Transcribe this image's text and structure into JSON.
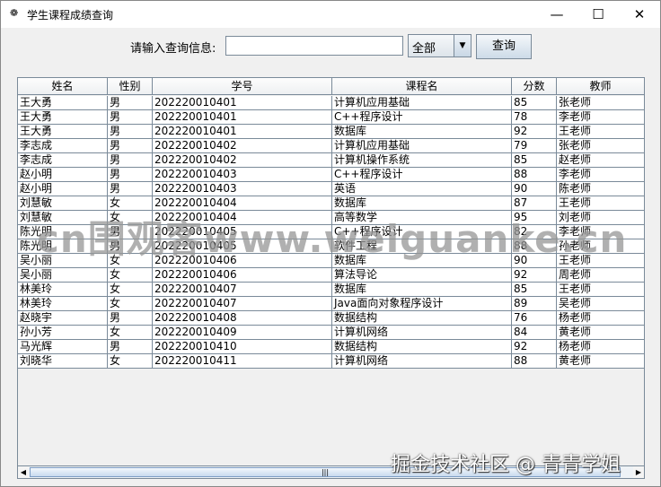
{
  "window": {
    "title": "学生课程成绩查询",
    "icon": "java-cup-icon"
  },
  "query": {
    "label": "请输入查询信息:",
    "input_value": "",
    "combo_value": "全部",
    "button": "查询"
  },
  "table": {
    "columns": [
      "姓名",
      "性别",
      "学号",
      "课程名",
      "分数",
      "教师"
    ],
    "rows": [
      [
        "王大勇",
        "男",
        "202220010401",
        "计算机应用基础",
        "85",
        "张老师"
      ],
      [
        "王大勇",
        "男",
        "202220010401",
        "C++程序设计",
        "78",
        "李老师"
      ],
      [
        "王大勇",
        "男",
        "202220010401",
        "数据库",
        "92",
        "王老师"
      ],
      [
        "李志成",
        "男",
        "202220010402",
        "计算机应用基础",
        "79",
        "张老师"
      ],
      [
        "李志成",
        "男",
        "202220010402",
        "计算机操作系统",
        "85",
        "赵老师"
      ],
      [
        "赵小明",
        "男",
        "202220010403",
        "C++程序设计",
        "88",
        "李老师"
      ],
      [
        "赵小明",
        "男",
        "202220010403",
        "英语",
        "90",
        "陈老师"
      ],
      [
        "刘慧敏",
        "女",
        "202220010404",
        "数据库",
        "87",
        "王老师"
      ],
      [
        "刘慧敏",
        "女",
        "202220010404",
        "高等数学",
        "95",
        "刘老师"
      ],
      [
        "陈光明",
        "男",
        "202220010405",
        "C++程序设计",
        "82",
        "李老师"
      ],
      [
        "陈光明",
        "男",
        "202220010405",
        "软件工程",
        "88",
        "孙老师"
      ],
      [
        "吴小丽",
        "女",
        "202220010406",
        "数据库",
        "90",
        "王老师"
      ],
      [
        "吴小丽",
        "女",
        "202220010406",
        "算法导论",
        "92",
        "周老师"
      ],
      [
        "林美玲",
        "女",
        "202220010407",
        "数据库",
        "85",
        "王老师"
      ],
      [
        "林美玲",
        "女",
        "202220010407",
        "Java面向对象程序设计",
        "89",
        "吴老师"
      ],
      [
        "赵晓宇",
        "男",
        "202220010408",
        "数据结构",
        "76",
        "杨老师"
      ],
      [
        "孙小芳",
        "女",
        "202220010409",
        "计算机网络",
        "84",
        "黄老师"
      ],
      [
        "马光辉",
        "男",
        "202220010410",
        "数据结构",
        "92",
        "杨老师"
      ],
      [
        "刘晓华",
        "女",
        "202220010411",
        "计算机网络",
        "88",
        "黄老师"
      ]
    ]
  },
  "watermarks": [
    "cn围观客www.weiguanke.cn",
    "掘金技术社区 @ 青青学姐"
  ]
}
